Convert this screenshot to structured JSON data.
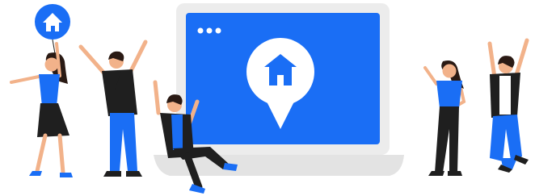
{
  "illustration": {
    "colors": {
      "accent": "#1a6ef5",
      "laptop_frame": "#ececec",
      "laptop_base": "#dcdcdc",
      "dark": "#1f1f1f",
      "skin": "#f2b28a",
      "hair": "#2a1a14",
      "white": "#ffffff"
    },
    "icons": {
      "screen": "house-location-pin-icon",
      "balloon": "house-balloon-icon",
      "window_controls": "window-dots-icon"
    }
  }
}
